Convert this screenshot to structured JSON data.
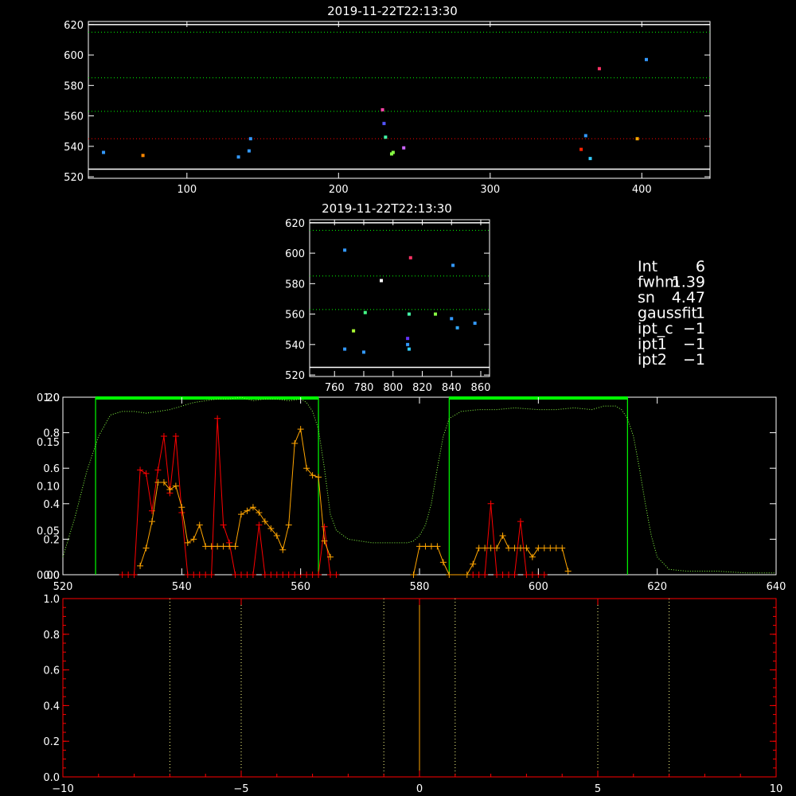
{
  "colors": {
    "background": "#000000",
    "axis": "#ffffff",
    "axis_bottom": "#ff0000",
    "guide_green": "#00ff00",
    "guide_red": "#ff0000",
    "series_red": "#ff0000",
    "series_orange": "#ffa500",
    "envelope_green": "#88ff44",
    "zero_line": "#ffa500"
  },
  "info": [
    {
      "key": "Int",
      "value": "6"
    },
    {
      "key": "fwhm",
      "value": "1.39"
    },
    {
      "key": "sn",
      "value": "4.47"
    },
    {
      "key": "gaussfit",
      "value": "1"
    },
    {
      "key": "ipt_c",
      "value": "−1"
    },
    {
      "key": "ipt1",
      "value": "−1"
    },
    {
      "key": "ipt2",
      "value": "−1"
    }
  ],
  "chart_data": [
    {
      "type": "scatter",
      "title": "2019-11-22T22:13:30",
      "xlim": [
        35,
        445
      ],
      "ylim": [
        519,
        622
      ],
      "x_ticks": [
        "100",
        "200",
        "300",
        "400"
      ],
      "x_tick_values": [
        100,
        200,
        300,
        400
      ],
      "y_ticks": [
        "520",
        "540",
        "560",
        "580",
        "600",
        "620"
      ],
      "y_tick_values": [
        520,
        540,
        560,
        580,
        600,
        620
      ],
      "hlines": [
        {
          "y": 525,
          "color": "white",
          "style": "solid"
        },
        {
          "y": 620,
          "color": "white",
          "style": "solid"
        },
        {
          "y": 545,
          "color": "red",
          "style": "dotted"
        },
        {
          "y": 563,
          "color": "green",
          "style": "dotted"
        },
        {
          "y": 585,
          "color": "green",
          "style": "dotted"
        },
        {
          "y": 615,
          "color": "green",
          "style": "dotted"
        }
      ],
      "points": [
        {
          "x": 45,
          "y": 536,
          "c": "#3399ff"
        },
        {
          "x": 71,
          "y": 534,
          "c": "#ff8800"
        },
        {
          "x": 134,
          "y": 533,
          "c": "#3399ff"
        },
        {
          "x": 141,
          "y": 537,
          "c": "#3399ff"
        },
        {
          "x": 142,
          "y": 545,
          "c": "#3399ff"
        },
        {
          "x": 229,
          "y": 564,
          "c": "#ff44aa"
        },
        {
          "x": 230,
          "y": 555,
          "c": "#5555ff"
        },
        {
          "x": 231,
          "y": 546,
          "c": "#44ffaa"
        },
        {
          "x": 235,
          "y": 535,
          "c": "#88ff44"
        },
        {
          "x": 236,
          "y": 536,
          "c": "#88ff44"
        },
        {
          "x": 243,
          "y": 539,
          "c": "#cc66ff"
        },
        {
          "x": 360,
          "y": 538,
          "c": "#ff2200"
        },
        {
          "x": 363,
          "y": 547,
          "c": "#3399ff"
        },
        {
          "x": 366,
          "y": 532,
          "c": "#33ccff"
        },
        {
          "x": 372,
          "y": 591,
          "c": "#ff3366"
        },
        {
          "x": 397,
          "y": 545,
          "c": "#ffaa00"
        },
        {
          "x": 403,
          "y": 597,
          "c": "#3399ff"
        }
      ]
    },
    {
      "type": "scatter",
      "title": "2019-11-22T22:13:30",
      "xlim": [
        743,
        866
      ],
      "ylim": [
        519,
        622
      ],
      "x_ticks": [
        "760",
        "780",
        "800",
        "820",
        "840",
        "860"
      ],
      "x_tick_values": [
        760,
        780,
        800,
        820,
        840,
        860
      ],
      "y_ticks": [
        "520",
        "540",
        "560",
        "580",
        "600",
        "620"
      ],
      "y_tick_values": [
        520,
        540,
        560,
        580,
        600,
        620
      ],
      "hlines": [
        {
          "y": 525,
          "color": "white",
          "style": "solid"
        },
        {
          "y": 620,
          "color": "white",
          "style": "solid"
        },
        {
          "y": 563,
          "color": "green",
          "style": "dotted"
        },
        {
          "y": 585,
          "color": "green",
          "style": "dotted"
        },
        {
          "y": 615,
          "color": "green",
          "style": "dotted"
        }
      ],
      "points": [
        {
          "x": 767,
          "y": 602,
          "c": "#3399ff"
        },
        {
          "x": 767,
          "y": 537,
          "c": "#3399ff"
        },
        {
          "x": 773,
          "y": 549,
          "c": "#aaff33"
        },
        {
          "x": 780,
          "y": 535,
          "c": "#3399ff"
        },
        {
          "x": 781,
          "y": 561,
          "c": "#44ff88"
        },
        {
          "x": 792,
          "y": 582,
          "c": "#ffffff"
        },
        {
          "x": 810,
          "y": 544,
          "c": "#6633ff"
        },
        {
          "x": 810,
          "y": 540,
          "c": "#3399ff"
        },
        {
          "x": 811,
          "y": 537,
          "c": "#33ccff"
        },
        {
          "x": 811,
          "y": 560,
          "c": "#44ffaa"
        },
        {
          "x": 812,
          "y": 597,
          "c": "#ff3366"
        },
        {
          "x": 829,
          "y": 560,
          "c": "#88ff44"
        },
        {
          "x": 840,
          "y": 557,
          "c": "#3399ff"
        },
        {
          "x": 841,
          "y": 592,
          "c": "#3399ff"
        },
        {
          "x": 844,
          "y": 551,
          "c": "#33aaff"
        },
        {
          "x": 856,
          "y": 554,
          "c": "#3399ff"
        }
      ]
    },
    {
      "type": "line",
      "xlim": [
        520,
        640
      ],
      "x_ticks": [
        "520",
        "540",
        "560",
        "580",
        "600",
        "620",
        "640"
      ],
      "x_tick_values": [
        520,
        540,
        560,
        580,
        600,
        620,
        640
      ],
      "ylim_left": [
        0,
        1.0
      ],
      "y_ticks_left": [
        "0.0",
        "0.2",
        "0.4",
        "0.6",
        "0.8",
        "1.0"
      ],
      "y_tick_values_left": [
        0.0,
        0.2,
        0.4,
        0.6,
        0.8,
        1.0
      ],
      "ylim_right": [
        0,
        0.2
      ],
      "y_ticks_right": [
        "0.00",
        "0.05",
        "0.10",
        "0.15",
        "0.20"
      ],
      "y_tick_values_right": [
        0.0,
        0.05,
        0.1,
        0.15,
        0.2
      ],
      "boxes": [
        {
          "x0": 525.5,
          "x1": 563,
          "y": 1.0
        },
        {
          "x0": 585,
          "x1": 615,
          "y": 1.0
        }
      ],
      "envelope": {
        "x": [
          520,
          522,
          524,
          526,
          528,
          530,
          532,
          534,
          536,
          538,
          540,
          542,
          544,
          546,
          548,
          550,
          552,
          554,
          556,
          558,
          560,
          561,
          562,
          563,
          564,
          565,
          566,
          568,
          570,
          572,
          574,
          576,
          578,
          579,
          580,
          581,
          582,
          583,
          584,
          585,
          587,
          590,
          593,
          596,
          600,
          603,
          606,
          609,
          611,
          613,
          614,
          615,
          616,
          617,
          618,
          619,
          620,
          622,
          625,
          630,
          635,
          640
        ],
        "y": [
          0.1,
          0.32,
          0.58,
          0.78,
          0.9,
          0.92,
          0.92,
          0.91,
          0.92,
          0.93,
          0.95,
          0.97,
          0.98,
          0.99,
          0.99,
          1.0,
          0.98,
          0.99,
          0.99,
          0.98,
          0.99,
          0.97,
          0.92,
          0.82,
          0.6,
          0.34,
          0.25,
          0.2,
          0.19,
          0.18,
          0.18,
          0.18,
          0.18,
          0.19,
          0.22,
          0.28,
          0.4,
          0.6,
          0.78,
          0.88,
          0.92,
          0.93,
          0.93,
          0.94,
          0.93,
          0.93,
          0.94,
          0.93,
          0.95,
          0.95,
          0.93,
          0.88,
          0.78,
          0.6,
          0.4,
          0.22,
          0.1,
          0.03,
          0.02,
          0.02,
          0.01,
          0.01
        ]
      },
      "series": [
        {
          "color": "red",
          "axis": "left",
          "x": [
            530,
            531,
            532,
            533,
            534,
            535,
            536,
            537,
            538,
            539,
            540,
            541,
            542,
            543,
            544,
            545,
            546,
            547,
            548,
            549,
            550,
            551,
            552,
            553,
            554,
            555,
            556,
            557,
            558,
            559,
            560,
            561,
            562,
            563,
            564,
            565,
            566
          ],
          "y": [
            0.0,
            0.0,
            0.0,
            0.59,
            0.57,
            0.36,
            0.59,
            0.78,
            0.46,
            0.78,
            0.35,
            0.0,
            0.0,
            0.0,
            0.0,
            0.0,
            0.88,
            0.28,
            0.18,
            0.0,
            0.0,
            0.0,
            0.0,
            0.28,
            0.0,
            0.0,
            0.0,
            0.0,
            0.0,
            0.0,
            0.0,
            0.0,
            0.0,
            0.0,
            0.27,
            0.0,
            0.0
          ]
        },
        {
          "color": "orange",
          "axis": "left",
          "x": [
            533,
            534,
            535,
            536,
            537,
            538,
            539,
            540,
            541,
            542,
            543,
            544,
            545,
            546,
            547,
            548,
            549,
            550,
            551,
            552,
            553,
            554,
            555,
            556,
            557,
            558,
            559,
            560,
            561,
            562,
            563,
            564,
            565
          ],
          "y": [
            0.05,
            0.15,
            0.3,
            0.52,
            0.52,
            0.48,
            0.5,
            0.38,
            0.18,
            0.2,
            0.28,
            0.16,
            0.16,
            0.16,
            0.16,
            0.16,
            0.16,
            0.34,
            0.36,
            0.38,
            0.35,
            0.3,
            0.26,
            0.22,
            0.14,
            0.28,
            0.74,
            0.82,
            0.6,
            0.56,
            0.55,
            0.19,
            0.1
          ]
        },
        {
          "color": "red",
          "axis": "left",
          "x": [
            589,
            590,
            591,
            592,
            593,
            594,
            595,
            596,
            597,
            598,
            599,
            600,
            601
          ],
          "y": [
            0.0,
            0.0,
            0.0,
            0.4,
            0.0,
            0.0,
            0.0,
            0.0,
            0.3,
            0.0,
            0.0,
            0.0,
            0.0
          ]
        },
        {
          "color": "orange",
          "axis": "left",
          "x": [
            579,
            580,
            581,
            582,
            583,
            584,
            585,
            588,
            589,
            590,
            591,
            592,
            593,
            594,
            595,
            596,
            597,
            598,
            599,
            600,
            601,
            602,
            603,
            604,
            605
          ],
          "y": [
            0.0,
            0.16,
            0.16,
            0.16,
            0.16,
            0.07,
            0.0,
            0.0,
            0.06,
            0.15,
            0.15,
            0.15,
            0.15,
            0.22,
            0.15,
            0.15,
            0.15,
            0.15,
            0.1,
            0.15,
            0.15,
            0.15,
            0.15,
            0.15,
            0.02
          ]
        }
      ]
    },
    {
      "type": "line",
      "xlim": [
        -10,
        10
      ],
      "x_ticks": [
        "−10",
        "−5",
        "0",
        "5",
        "10"
      ],
      "x_tick_values": [
        -10,
        -5,
        0,
        5,
        10
      ],
      "ylim": [
        0,
        1.0
      ],
      "y_ticks": [
        "0.0",
        "0.2",
        "0.4",
        "0.6",
        "0.8",
        "1.0"
      ],
      "y_tick_values": [
        0.0,
        0.2,
        0.4,
        0.6,
        0.8,
        1.0
      ],
      "vlines_dotted": [
        -7,
        -5,
        -1,
        1,
        5,
        7
      ],
      "vline_solid": 0
    }
  ]
}
